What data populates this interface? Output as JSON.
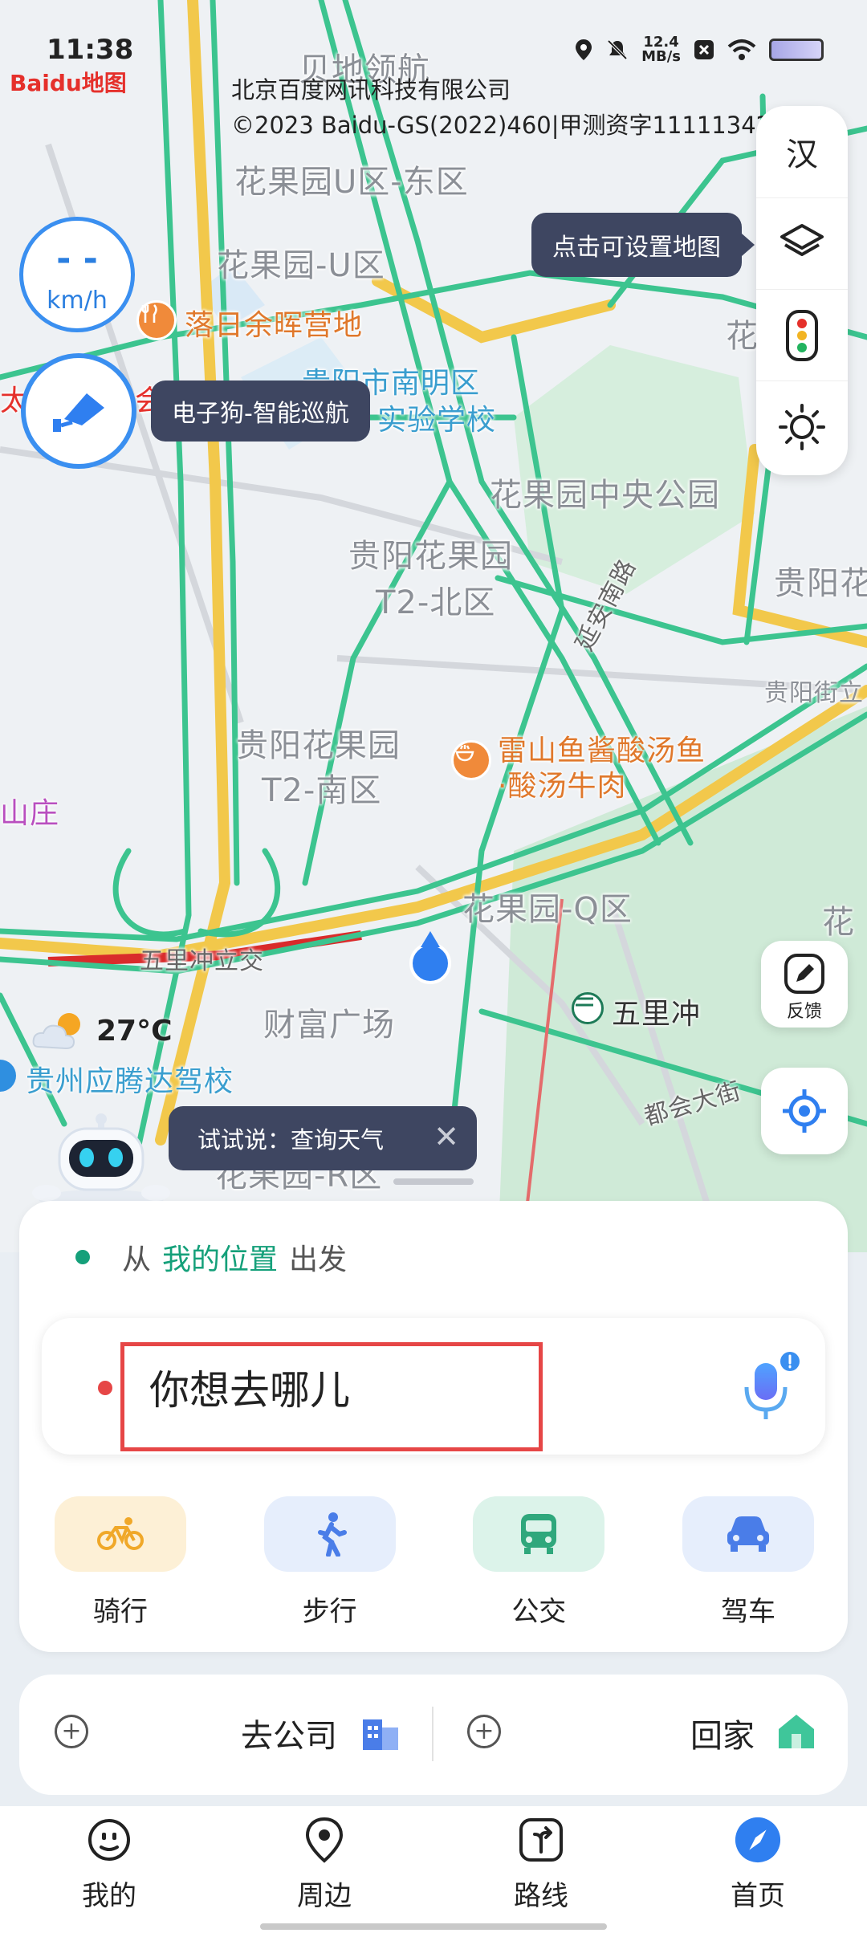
{
  "status": {
    "time": "11:38",
    "speed_value": "12.4",
    "speed_unit": "MB/s"
  },
  "map": {
    "logo": "Baidu地图",
    "copyright_line1": "北京百度网讯科技有限公司",
    "copyright_line2": "©2023 Baidu-GS(2022)460|甲测资字11111342",
    "labels": {
      "bei_di": "贝地领航",
      "hgy_u_east": "花果园U区-东区",
      "hgy_u": "花果园-U区",
      "luori": "落日余晖营地",
      "nanming_1": "贵阳市南明区",
      "nanming_2": "实验学校",
      "central_park": "花果园中央公园",
      "t2_north_1": "贵阳花果园",
      "t2_north_2": "T2-北区",
      "yan_an_road": "延安南路",
      "guiyang_right": "贵阳花",
      "guiyang_jie": "贵阳街立",
      "t2_south_1": "贵阳花果园",
      "t2_south_2": "T2-南区",
      "leishan_1": "雷山鱼酱酸汤鱼",
      "leishan_2": "·酸汤牛肉",
      "shanzhuang": "山庄",
      "hgy_q": "花果园-Q区",
      "hua_right": "花",
      "wulichong_overpass": "五里冲立交",
      "caifu": "财富广场",
      "wulichong": "五里冲",
      "yingtengda": "贵州应腾达驾校",
      "duhui": "都会大街",
      "hgy_r": "花果园-R区",
      "hua_right_top": "花",
      "dagong": "太",
      "hui": "会"
    }
  },
  "toolbar": {
    "lang": "汉",
    "layer_tip": "点击可设置地图"
  },
  "speedometer": {
    "value": "- -",
    "unit": "km/h"
  },
  "camera": {
    "tip": "电子狗-智能巡航"
  },
  "feedback": {
    "label": "反馈"
  },
  "weather": {
    "temp": "27°C"
  },
  "assistant": {
    "tip": "试试说：查询天气",
    "close": "✕"
  },
  "route": {
    "from_prefix": "从",
    "from_location": "我的位置",
    "from_suffix": "出发",
    "dest_placeholder": "你想去哪儿",
    "modes": [
      {
        "label": "骑行",
        "icon": "bicycle-icon"
      },
      {
        "label": "步行",
        "icon": "walking-icon"
      },
      {
        "label": "公交",
        "icon": "bus-icon"
      },
      {
        "label": "驾车",
        "icon": "car-icon"
      }
    ]
  },
  "shortcuts": {
    "work": "去公司",
    "home": "回家"
  },
  "nav": [
    {
      "label": "我的",
      "icon": "face-icon"
    },
    {
      "label": "周边",
      "icon": "location-pin-icon"
    },
    {
      "label": "路线",
      "icon": "route-icon"
    },
    {
      "label": "首页",
      "icon": "compass-icon"
    }
  ],
  "colors": {
    "accent_blue": "#3a8ff0",
    "accent_green": "#15a07a",
    "highlight_red": "#e64646",
    "road_green": "#3cc48f",
    "road_yellow": "#f2c84b"
  }
}
